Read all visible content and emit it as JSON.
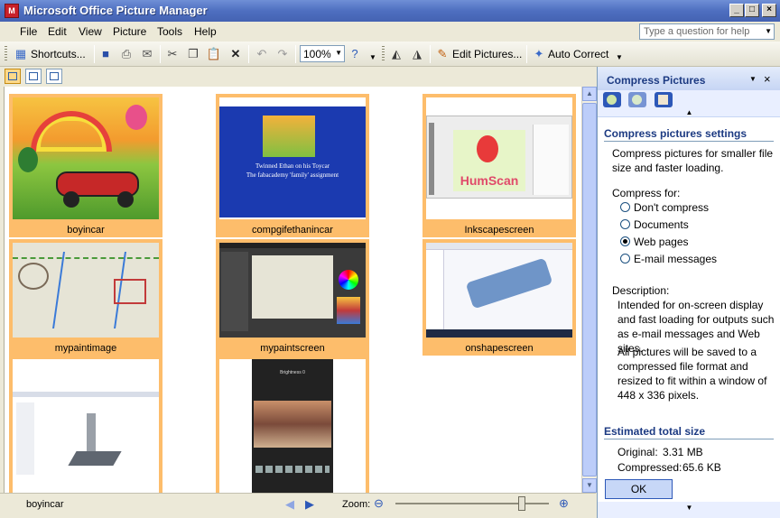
{
  "window": {
    "title": "Microsoft Office Picture Manager",
    "icon": "picture-manager-icon"
  },
  "menu": [
    "File",
    "Edit",
    "View",
    "Picture",
    "Tools",
    "Help"
  ],
  "ask": {
    "placeholder": "Type a question for help"
  },
  "toolbar": {
    "shortcuts_label": "Shortcuts...",
    "zoom_value": "100%",
    "edit_pictures_label": "Edit Pictures...",
    "auto_correct_label": "Auto Correct"
  },
  "thumbnails": [
    {
      "label": "boyincar"
    },
    {
      "label": "compgifethanincar",
      "caption1": "Twinned Ethan on his Toycar",
      "caption2": "The fabacademy 'family' assignment"
    },
    {
      "label": "Inkscapescreen",
      "logo": "HumScan"
    },
    {
      "label": "mypaintimage"
    },
    {
      "label": "mypaintscreen"
    },
    {
      "label": "onshapescreen"
    },
    {
      "label": ""
    },
    {
      "label": "",
      "phone_title": "Brightness 0"
    }
  ],
  "status": {
    "filename": "boyincar",
    "zoom_label": "Zoom:"
  },
  "panel": {
    "title": "Compress Pictures",
    "settings_title": "Compress pictures settings",
    "intro": "Compress pictures for smaller file size and faster loading.",
    "compress_for_label": "Compress for:",
    "options": [
      "Don't compress",
      "Documents",
      "Web pages",
      "E-mail messages"
    ],
    "selected_option": "Web pages",
    "description_label": "Description:",
    "description": "Intended for on-screen display and fast loading for outputs such as e-mail messages and Web sites.",
    "note": "All pictures will be saved to a compressed file format and resized to fit within a window of 448 x 336 pixels.",
    "size_title": "Estimated total size",
    "original_label": "Original:",
    "original_value": "3.31 MB",
    "compressed_label": "Compressed:",
    "compressed_value": "65.6 KB",
    "ok_label": "OK"
  }
}
